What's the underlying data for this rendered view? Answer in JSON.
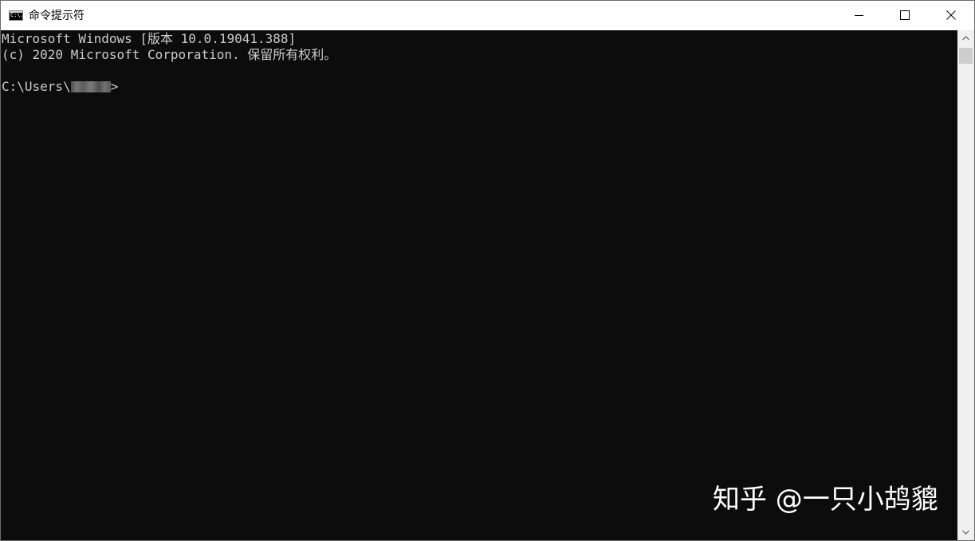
{
  "window": {
    "title": "命令提示符",
    "icon": "cmd-icon",
    "icon_text": "C:\\."
  },
  "caption_buttons": {
    "minimize": "minimize-icon",
    "maximize": "maximize-icon",
    "close": "close-icon"
  },
  "console": {
    "lines": [
      "Microsoft Windows [版本 10.0.19041.388]",
      "(c) 2020 Microsoft Corporation. 保留所有权利。",
      ""
    ],
    "prompt_prefix": "C:\\Users\\",
    "prompt_suffix": ">",
    "background_color": "#0c0c0c",
    "text_color": "#cccccc"
  },
  "watermark": {
    "text": "知乎 @一只小鸪貔"
  }
}
